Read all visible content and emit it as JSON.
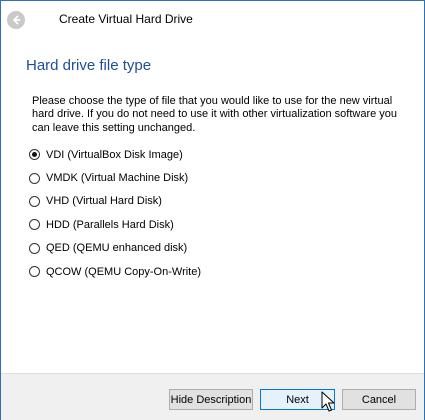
{
  "window": {
    "title": "Create Virtual Hard Drive"
  },
  "page": {
    "title": "Hard drive file type",
    "description": "Please choose the type of file that you would like to use for the new virtual hard drive. If you do not need to use it with other virtualization software you can leave this setting unchanged."
  },
  "options": [
    {
      "label": "VDI (VirtualBox Disk Image)",
      "selected": true
    },
    {
      "label": "VMDK (Virtual Machine Disk)",
      "selected": false
    },
    {
      "label": "VHD (Virtual Hard Disk)",
      "selected": false
    },
    {
      "label": "HDD (Parallels Hard Disk)",
      "selected": false
    },
    {
      "label": "QED (QEMU enhanced disk)",
      "selected": false
    },
    {
      "label": "QCOW (QEMU Copy-On-Write)",
      "selected": false
    }
  ],
  "buttons": {
    "hide_description": "Hide Description",
    "next": "Next",
    "cancel": "Cancel"
  },
  "icons": {
    "back": "back-arrow-icon",
    "cursor": "mouse-pointer-icon"
  },
  "colors": {
    "title_accent": "#1f4e99",
    "window_border": "#2b6fbd",
    "default_button_border": "#0078d7"
  }
}
